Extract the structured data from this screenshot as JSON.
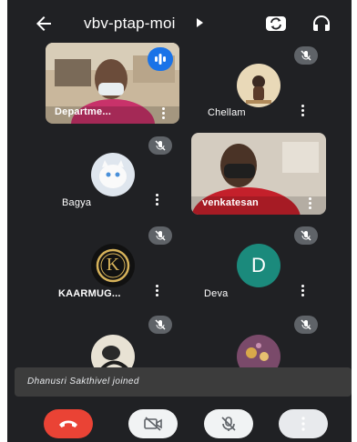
{
  "header": {
    "meeting_title": "vbv-ptap-moi",
    "icons": [
      "back-arrow-icon",
      "caret-right-icon",
      "switch-camera-icon",
      "headphones-icon"
    ]
  },
  "participants": [
    {
      "name": "Departme...",
      "video": true,
      "speaking": true
    },
    {
      "name": "Chellam",
      "video": false,
      "muted": true
    },
    {
      "name": "Bagya",
      "video": false,
      "muted": true
    },
    {
      "name": "venkatesan",
      "video": true
    },
    {
      "name": "KAARMUG...",
      "video": false,
      "muted": true,
      "avatar_letter": "K"
    },
    {
      "name": "Deva",
      "video": false,
      "muted": true,
      "avatar_letter": "D"
    },
    {
      "name": "",
      "video": false,
      "muted": true
    },
    {
      "name": "",
      "video": false,
      "muted": true
    }
  ],
  "toast": {
    "message": "Dhanusri Sakthivel joined"
  },
  "controls": {
    "icons": [
      "end-call-icon",
      "camera-off-icon",
      "mic-off-icon",
      "more-options-icon"
    ]
  },
  "colors": {
    "background": "#202124",
    "end_call": "#ea4335",
    "speaking": "#1a73e8",
    "avatar_d": "#1b8a7c"
  }
}
